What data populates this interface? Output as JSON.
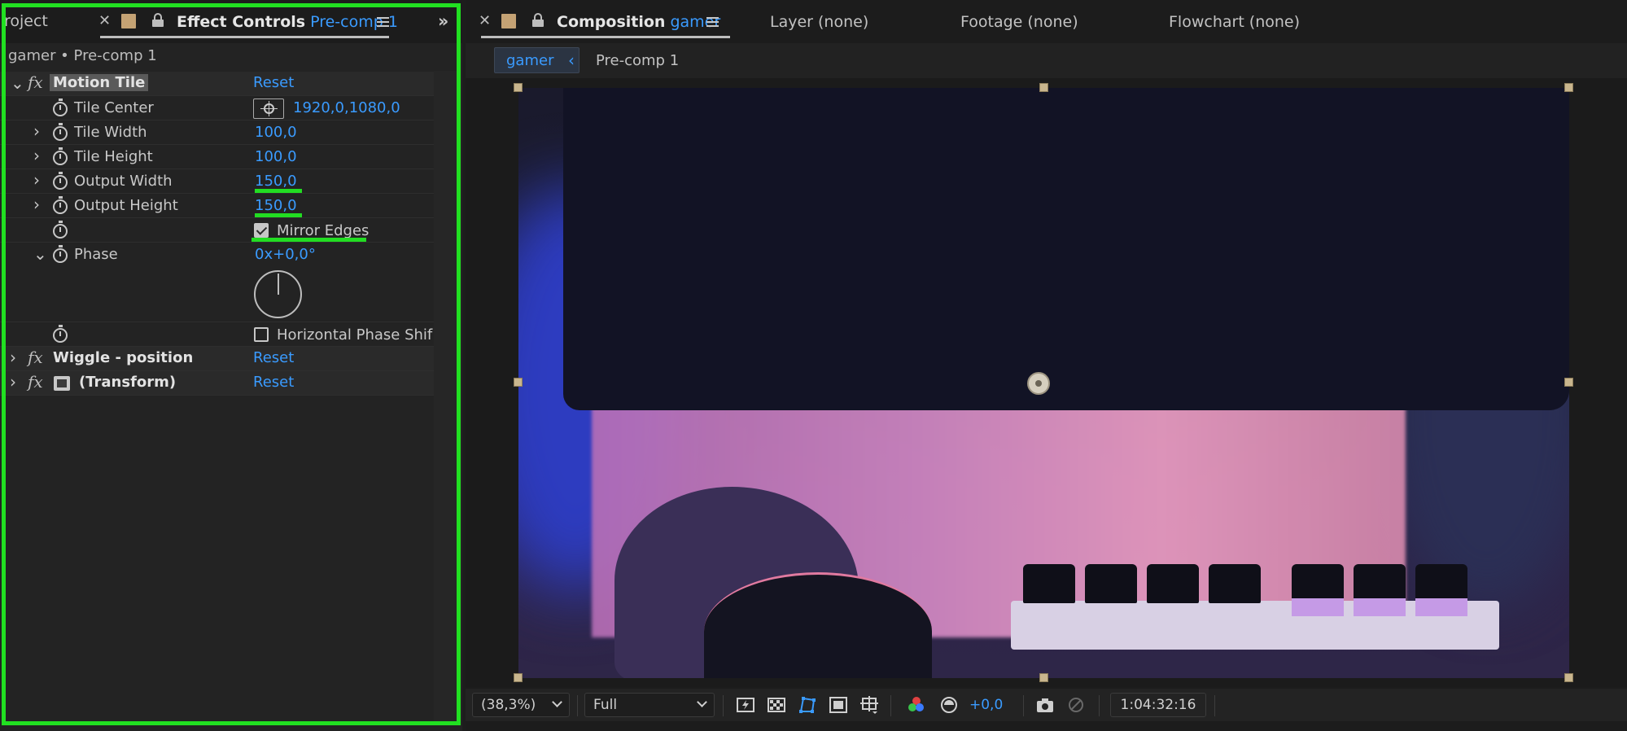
{
  "left_panel": {
    "project_tab": "roject",
    "effect_controls_label": "Effect Controls",
    "effect_controls_target": "Pre-comp 1",
    "subheader": "gamer • Pre-comp 1",
    "effects": {
      "motion_tile": {
        "name": "Motion Tile",
        "reset": "Reset",
        "props": {
          "tile_center": {
            "label": "Tile Center",
            "value": "1920,0,1080,0"
          },
          "tile_width": {
            "label": "Tile Width",
            "value": "100,0"
          },
          "tile_height": {
            "label": "Tile Height",
            "value": "100,0"
          },
          "output_width": {
            "label": "Output Width",
            "value": "150,0"
          },
          "output_height": {
            "label": "Output Height",
            "value": "150,0"
          },
          "mirror_edges": {
            "label": "Mirror Edges",
            "checked": true
          },
          "phase": {
            "label": "Phase",
            "value_prefix": "0x",
            "value_suffix": "+0,0°"
          },
          "horizontal_phase_shift": {
            "label": "Horizontal Phase Shif",
            "checked": false
          }
        }
      },
      "wiggle": {
        "name": "Wiggle - position",
        "reset": "Reset"
      },
      "transform": {
        "name": "(Transform)",
        "reset": "Reset"
      }
    }
  },
  "right_panel": {
    "composition_label": "Composition",
    "composition_name": "gamer",
    "tabs": {
      "layer": "Layer (none)",
      "footage": "Footage (none)",
      "flowchart": "Flowchart (none)"
    },
    "breadcrumbs": {
      "active": "gamer",
      "next": "Pre-comp 1"
    },
    "toolbar": {
      "zoom": "(38,3%)",
      "resolution": "Full",
      "exposure": "+0,0",
      "timecode": "1:04:32:16"
    }
  },
  "colors": {
    "accent_blue": "#3a9bff",
    "highlight_green": "#21e021",
    "panel_bg": "#232323",
    "label_swatch": "#c4a274"
  }
}
